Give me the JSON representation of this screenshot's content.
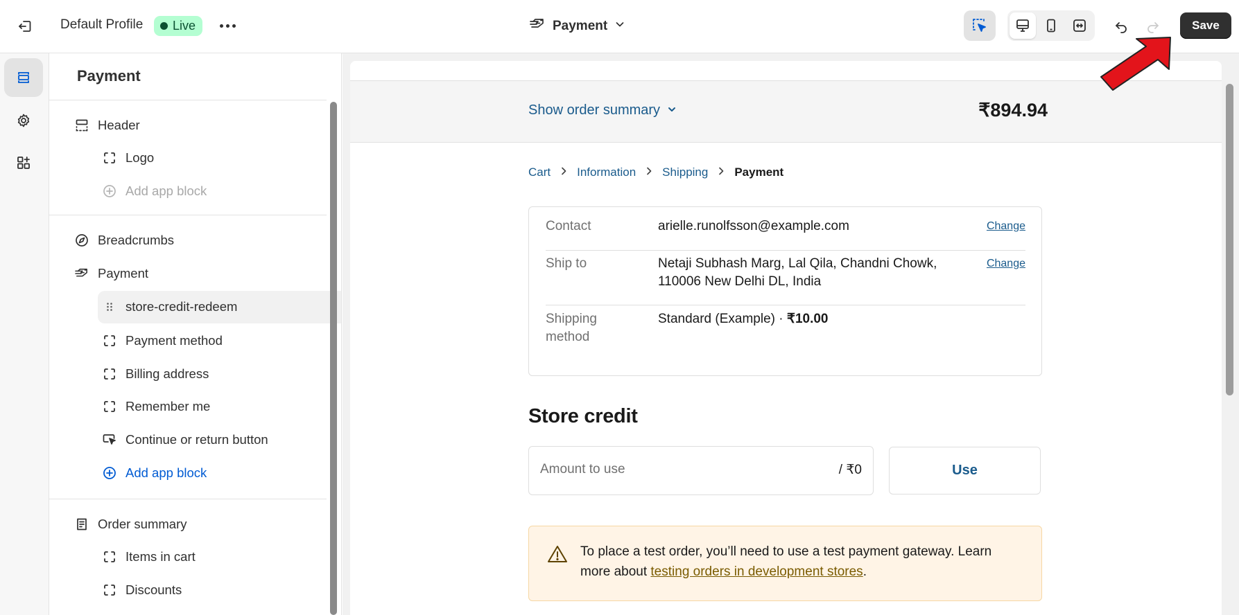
{
  "topbar": {
    "profile_name": "Default Profile",
    "status_badge": "Live",
    "page_selector": "Payment",
    "save_label": "Save"
  },
  "sidebar": {
    "title": "Payment",
    "sections": {
      "header": {
        "label": "Header",
        "children": [
          "Logo"
        ],
        "add_app_block": "Add app block"
      },
      "breadcrumbs": {
        "label": "Breadcrumbs"
      },
      "payment": {
        "label": "Payment",
        "children": [
          "store-credit-redeem",
          "Payment method",
          "Billing address",
          "Remember me",
          "Continue or return button"
        ],
        "add_app_block": "Add app block"
      },
      "order_summary": {
        "label": "Order summary",
        "children": [
          "Items in cart",
          "Discounts"
        ]
      }
    }
  },
  "preview": {
    "show_order_summary": "Show order summary",
    "order_total": "₹894.94",
    "breadcrumbs": [
      "Cart",
      "Information",
      "Shipping",
      "Payment"
    ],
    "review": {
      "contact_label": "Contact",
      "contact_value": "arielle.runolfsson@example.com",
      "ship_to_label": "Ship to",
      "ship_to_line1": "Netaji Subhash Marg, Lal Qila, Chandni Chowk,",
      "ship_to_line2": "110006 New Delhi DL, India",
      "shipping_method_label_1": "Shipping",
      "shipping_method_label_2": "method",
      "shipping_method_name": "Standard (Example) · ",
      "shipping_method_price": "₹10.00",
      "change_label": "Change"
    },
    "store_credit": {
      "title": "Store credit",
      "amount_placeholder": "Amount to use",
      "amount_suffix": "/ ₹0",
      "use_label": "Use"
    },
    "warning": {
      "text_before": "To place a test order, you’ll need to use a test payment gateway. Learn more about ",
      "link_text": "testing orders in development stores",
      "text_after": "."
    }
  },
  "colors": {
    "accent_blue": "#005bd3",
    "checkout_link": "#1a5b8c",
    "live_badge_bg": "#b4fed2",
    "save_button": "#303030",
    "annotation_arrow": "#e3141b"
  },
  "icons": {
    "exit": "exit-icon",
    "more": "more-horizontal-icon",
    "payment": "payment-icon",
    "chevron": "chevron-down-icon",
    "inspector": "select-cursor-icon",
    "desktop": "desktop-icon",
    "mobile": "mobile-icon",
    "fullscreen": "expand-icon",
    "undo": "undo-icon",
    "redo": "redo-icon",
    "sections": "sections-icon",
    "settings": "gear-icon",
    "apps": "apps-icon"
  }
}
